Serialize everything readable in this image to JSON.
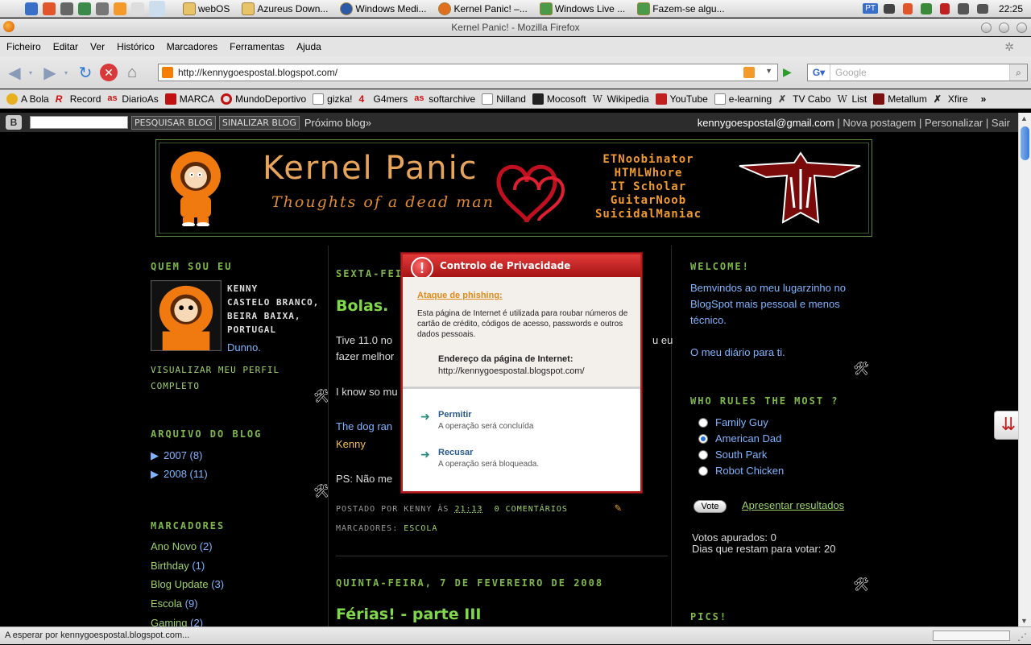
{
  "menubar": {
    "tasks": [
      "webOS",
      "Azureus Down...",
      "Windows Medi...",
      "Kernel Panic! –...",
      "Windows Live ...",
      "Fazem-se algu..."
    ],
    "lang": "PT",
    "clock": "22:25"
  },
  "window": {
    "title": "Kernel Panic! - Mozilla Firefox"
  },
  "appmenu": [
    "Ficheiro",
    "Editar",
    "Ver",
    "Histórico",
    "Marcadores",
    "Ferramentas",
    "Ajuda"
  ],
  "navbar": {
    "url": "http://kennygoespostal.blogspot.com/",
    "search_placeholder": "Google"
  },
  "bookmarks": [
    "A Bola",
    "Record",
    "DiarioAs",
    "MARCA",
    "MundoDeportivo",
    "gizka!",
    "G4mers",
    "softarchive",
    "Nilland",
    "Mocosoft",
    "Wikipedia",
    "YouTube",
    "e-learning",
    "TV Cabo",
    "List",
    "Metallum",
    "Xfire"
  ],
  "blognav": {
    "search_btn": "PESQUISAR BLOG",
    "flag_btn": "SINALIZAR BLOG",
    "next": "Próximo blog»",
    "email": "kennygoespostal@gmail.com",
    "new_post": "Nova postagem",
    "customize": "Personalizar",
    "logout": "Sair"
  },
  "header": {
    "title": "Kernel Panic",
    "subtitle": "Thoughts of a dead man",
    "tags": [
      "ETNoobinator",
      "HTMLWhore",
      "IT Scholar",
      "GuitarNoob",
      "SuicidalManiac"
    ]
  },
  "left": {
    "about_title": "QUEM SOU EU",
    "name_lines": [
      "KENNY",
      "CASTELO BRANCO,",
      "BEIRA BAIXA,",
      "PORTUGAL"
    ],
    "dunno": "Dunno.",
    "view_profile": "VISUALIZAR MEU PERFIL COMPLETO",
    "archive_title": "ARQUIVO DO BLOG",
    "archive": [
      {
        "year": "2007",
        "count": "(8)"
      },
      {
        "year": "2008",
        "count": "(11)"
      }
    ],
    "labels_title": "MARCADORES",
    "labels": [
      {
        "name": "Ano Novo",
        "count": "(2)"
      },
      {
        "name": "Birthday",
        "count": "(1)"
      },
      {
        "name": "Blog Update",
        "count": "(3)"
      },
      {
        "name": "Escola",
        "count": "(9)"
      },
      {
        "name": "Gaming",
        "count": "(2)"
      }
    ]
  },
  "main": {
    "post1_date": "SEXTA-FEI",
    "post1_title": "Bolas.",
    "post1_line1a": "Tive 11.0 no",
    "post1_line1b": "u eu",
    "post1_line2": "fazer melhor",
    "post1_line3": "I know so mu",
    "post1_link": "The dog ran",
    "post1_sig": "Kenny",
    "post1_ps": "PS: Não me",
    "post1_footer_by": "POSTADO POR KENNY ÀS",
    "post1_footer_time": "21:13",
    "post1_footer_comments": "0 COMENTÁRIOS",
    "post1_labels_label": "MARCADORES:",
    "post1_labels_value": "ESCOLA",
    "post2_date": "QUINTA-FEIRA, 7 DE FEVEREIRO DE 2008",
    "post2_title": "Férias! - parte III"
  },
  "right": {
    "welcome_title": "WELCOME!",
    "welcome_text": "Bemvindos ao meu lugarzinho no BlogSpot mais pessoal e menos técnico.",
    "diary": "O meu diário para ti.",
    "poll_title": "WHO RULES THE MOST ?",
    "poll_options": [
      "Family Guy",
      "American Dad",
      "South Park",
      "Robot Chicken"
    ],
    "poll_selected": "American Dad",
    "vote_btn": "Vote",
    "results_link": "Apresentar resultados",
    "votes_line": "Votos apurados: 0",
    "days_line": "Dias que restam para votar: 20",
    "pics_title": "PICS!"
  },
  "dialog": {
    "title": "Controlo de Privacidade",
    "phish_title": "Ataque de phishing:",
    "desc": "Esta página de Internet é utilizada para roubar números de cartão de crédito, códigos de acesso, passwords e outros dados pessoais.",
    "address_label": "Endereço da página de Internet:",
    "address": "http://kennygoespostal.blogspot.com/",
    "allow": "Permitir",
    "allow_sub": "A operação será concluída",
    "deny": "Recusar",
    "deny_sub": "A operação será bloqueada."
  },
  "status": {
    "text": "A esperar por kennygoespostal.blogspot.com..."
  },
  "colors": {
    "blog_green": "#7fb84a",
    "blog_link": "#7fb4ff",
    "dialog_red": "#b81c1c",
    "header_orange": "#e6a55a"
  }
}
